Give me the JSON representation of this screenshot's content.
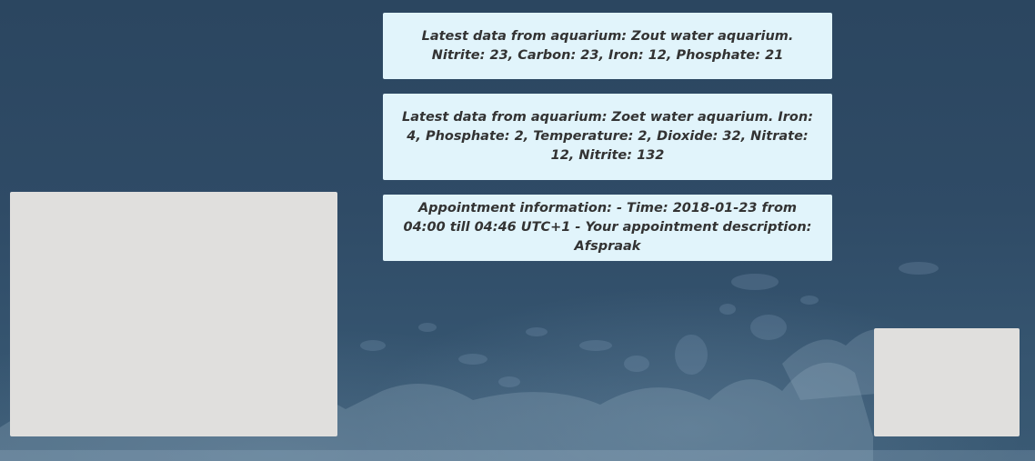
{
  "cards": [
    {
      "text": "Latest data from aquarium: Zout water aquarium. Nitrite: 23, Carbon: 23, Iron: 12, Phosphate: 21"
    },
    {
      "text": "Latest data from aquarium: Zoet water aquarium. Iron: 4, Phosphate: 2, Temperature: 2, Dioxide: 32, Nitrate: 12, Nitrite: 132"
    },
    {
      "text": "Appointment information: - Time: 2018-01-23 from 04:00 till 04:46 UTC+1 - Your appointment description: Afspraak"
    }
  ],
  "colors": {
    "card_background": "#e1f4fb",
    "page_background": "#2e4a63",
    "panel_background": "#e0dfdd"
  }
}
